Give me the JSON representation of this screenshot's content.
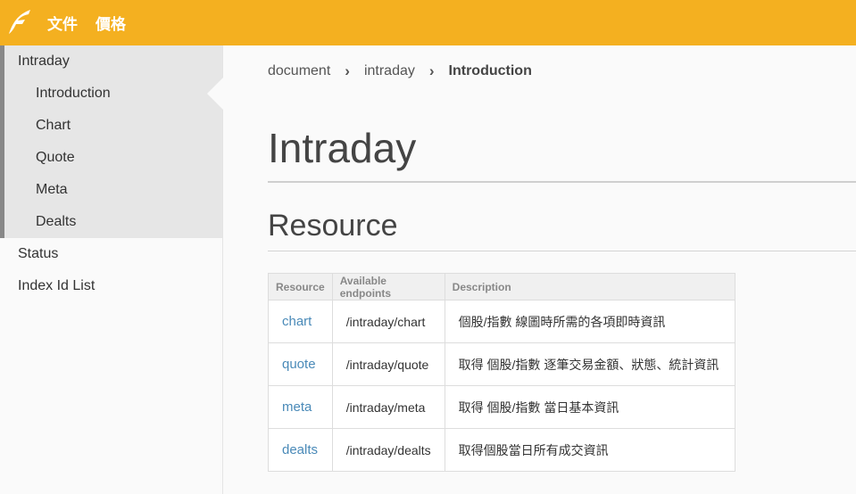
{
  "topnav": {
    "docs": "文件",
    "pricing": "價格"
  },
  "colors": {
    "brand": "#f4b020",
    "link": "#4a8ab8"
  },
  "sidebar": {
    "group_label": "Intraday",
    "group_items": [
      {
        "label": "Introduction",
        "active": true
      },
      {
        "label": "Chart"
      },
      {
        "label": "Quote"
      },
      {
        "label": "Meta"
      },
      {
        "label": "Dealts"
      }
    ],
    "items": [
      {
        "label": "Status"
      },
      {
        "label": "Index Id List"
      }
    ]
  },
  "breadcrumb": {
    "items": [
      "document",
      "intraday"
    ],
    "current": "Introduction"
  },
  "page_title": "Intraday",
  "section_title": "Resource",
  "table": {
    "headers": [
      "Resource",
      "Available endpoints",
      "Description"
    ],
    "rows": [
      {
        "resource": "chart",
        "endpoint": "/intraday/chart",
        "description": "個股/指數 線圖時所需的各項即時資訊"
      },
      {
        "resource": "quote",
        "endpoint": "/intraday/quote",
        "description": "取得 個股/指數 逐筆交易金額、狀態、統計資訊"
      },
      {
        "resource": "meta",
        "endpoint": "/intraday/meta",
        "description": "取得 個股/指數 當日基本資訊"
      },
      {
        "resource": "dealts",
        "endpoint": "/intraday/dealts",
        "description": "取得個股當日所有成交資訊"
      }
    ]
  }
}
